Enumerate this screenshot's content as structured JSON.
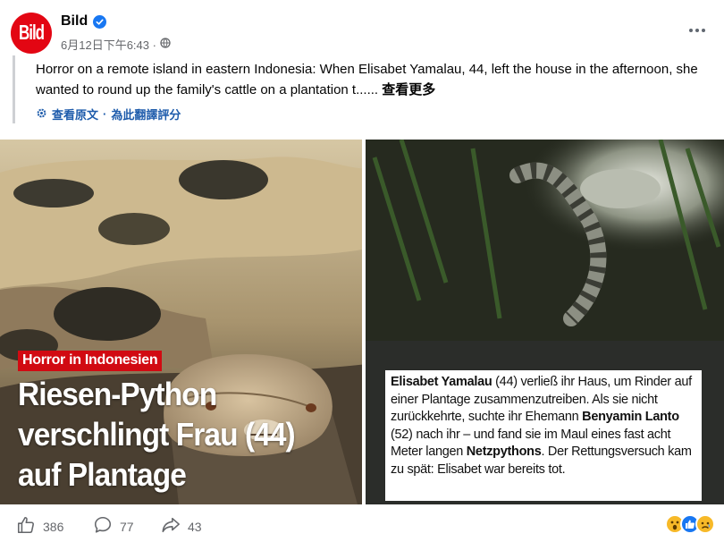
{
  "post": {
    "page_name": "Bild",
    "avatar_text": "Bild",
    "timestamp": "6月12日下午6:43 · ",
    "text": "Horror on a remote island in eastern Indonesia: When Elisabet Yamalau, 44, left the house in the afternoon, she wanted to round up the family's cattle on a plantation t......",
    "see_more": "查看更多",
    "see_original": "查看原文",
    "separator": " · ",
    "rate_translation": "為此翻譯評分"
  },
  "image_left": {
    "tag": "Horror in Indonesien",
    "headline": "Riesen-Python verschlingt Frau (44) auf Plantage"
  },
  "image_right": {
    "caption_1_bold": "Elisabet Yamalau",
    "caption_1": " (44) verließ ihr Haus, um Rinder auf einer Plantage zusammenzutreiben. Als sie nicht zurückkehrte, suchte ihr Ehemann ",
    "caption_2_bold": "Benyamin Lanto",
    "caption_2": " (52) nach ihr – und fand sie im Maul eines fast acht Meter langen ",
    "caption_3_bold": "Netzpythons",
    "caption_3": ". Der Rettungsversuch kam zu spät: Elisabet war bereits tot."
  },
  "footer": {
    "likes": "386",
    "comments": "77",
    "shares": "43"
  },
  "icons": {
    "verified": "verified-badge-icon",
    "globe": "globe-icon",
    "more": "more-options-icon",
    "translate": "translate-gear-icon",
    "like": "like-icon",
    "comment": "comment-icon",
    "share": "share-icon",
    "reactions": [
      "wow-reaction-icon",
      "like-reaction-icon",
      "sad-reaction-icon"
    ]
  },
  "colors": {
    "brand": "#e30613",
    "verified": "#1877f2",
    "link": "#1d5bab",
    "tag": "#d10a12"
  }
}
